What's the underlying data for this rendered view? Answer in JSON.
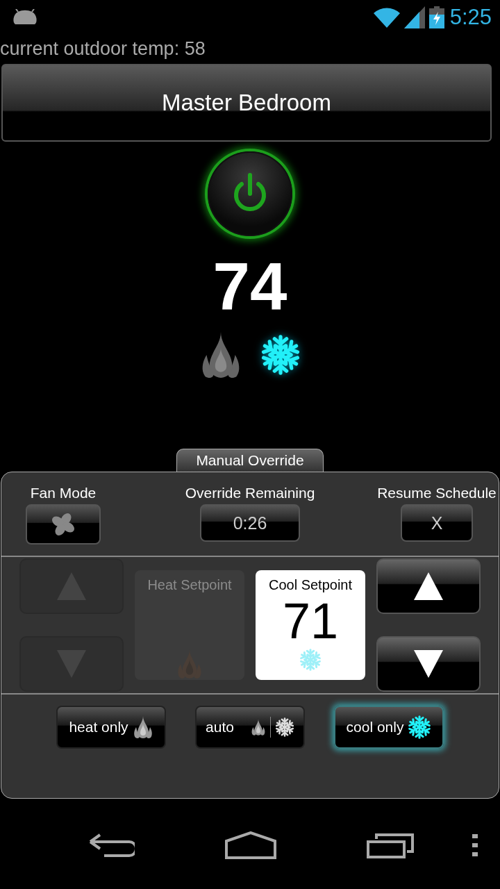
{
  "status_bar": {
    "time": "5:25"
  },
  "outdoor_temp": "current outdoor temp: 58",
  "zone_button": "Master Bedroom",
  "power": {
    "on": true
  },
  "current_temp": "74",
  "indicators": {
    "heating": false,
    "cooling": true
  },
  "override": {
    "title": "Manual Override",
    "controls": [
      {
        "label": "Fan Mode",
        "kind": "fan"
      },
      {
        "label": "Override Remaining",
        "kind": "text",
        "value": "0:26"
      },
      {
        "label": "Resume Schedule",
        "kind": "text",
        "value": "X"
      }
    ],
    "setpoints": [
      {
        "label": "Heat Setpoint",
        "kind": "heat",
        "disabled": true
      },
      {
        "label": "Cool Setpoint",
        "kind": "cool",
        "value": "71",
        "disabled": false
      }
    ],
    "modes": [
      {
        "label": "heat only",
        "kind": "heat",
        "selected": false
      },
      {
        "label": "auto",
        "kind": "auto",
        "selected": false
      },
      {
        "label": "cool only",
        "kind": "cool",
        "selected": true
      }
    ]
  }
}
